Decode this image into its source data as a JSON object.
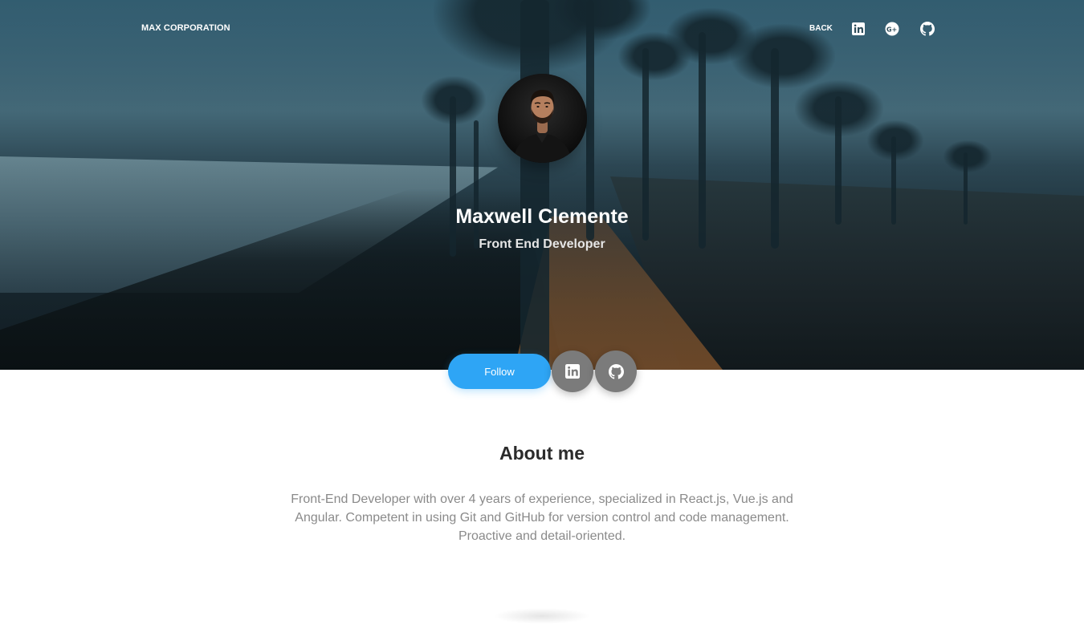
{
  "nav": {
    "brand": "MAX CORPORATION",
    "back_label": "BACK",
    "icons": [
      "linkedin-icon",
      "google-plus-icon",
      "github-icon"
    ]
  },
  "profile": {
    "name": "Maxwell Clemente",
    "role": "Front End Developer"
  },
  "actions": {
    "follow_label": "Follow",
    "icons": [
      "linkedin-icon",
      "github-icon"
    ]
  },
  "about": {
    "title": "About me",
    "text": "Front-End Developer with over 4 years of experience, specialized in React.js, Vue.js and Angular. Competent in using Git and GitHub for version control and code management. Proactive and detail-oriented."
  },
  "colors": {
    "accent": "#2ea5f5",
    "icon_button": "#7b7b7b",
    "heading": "#2b2b2b",
    "body_text": "#8a8a8a"
  }
}
